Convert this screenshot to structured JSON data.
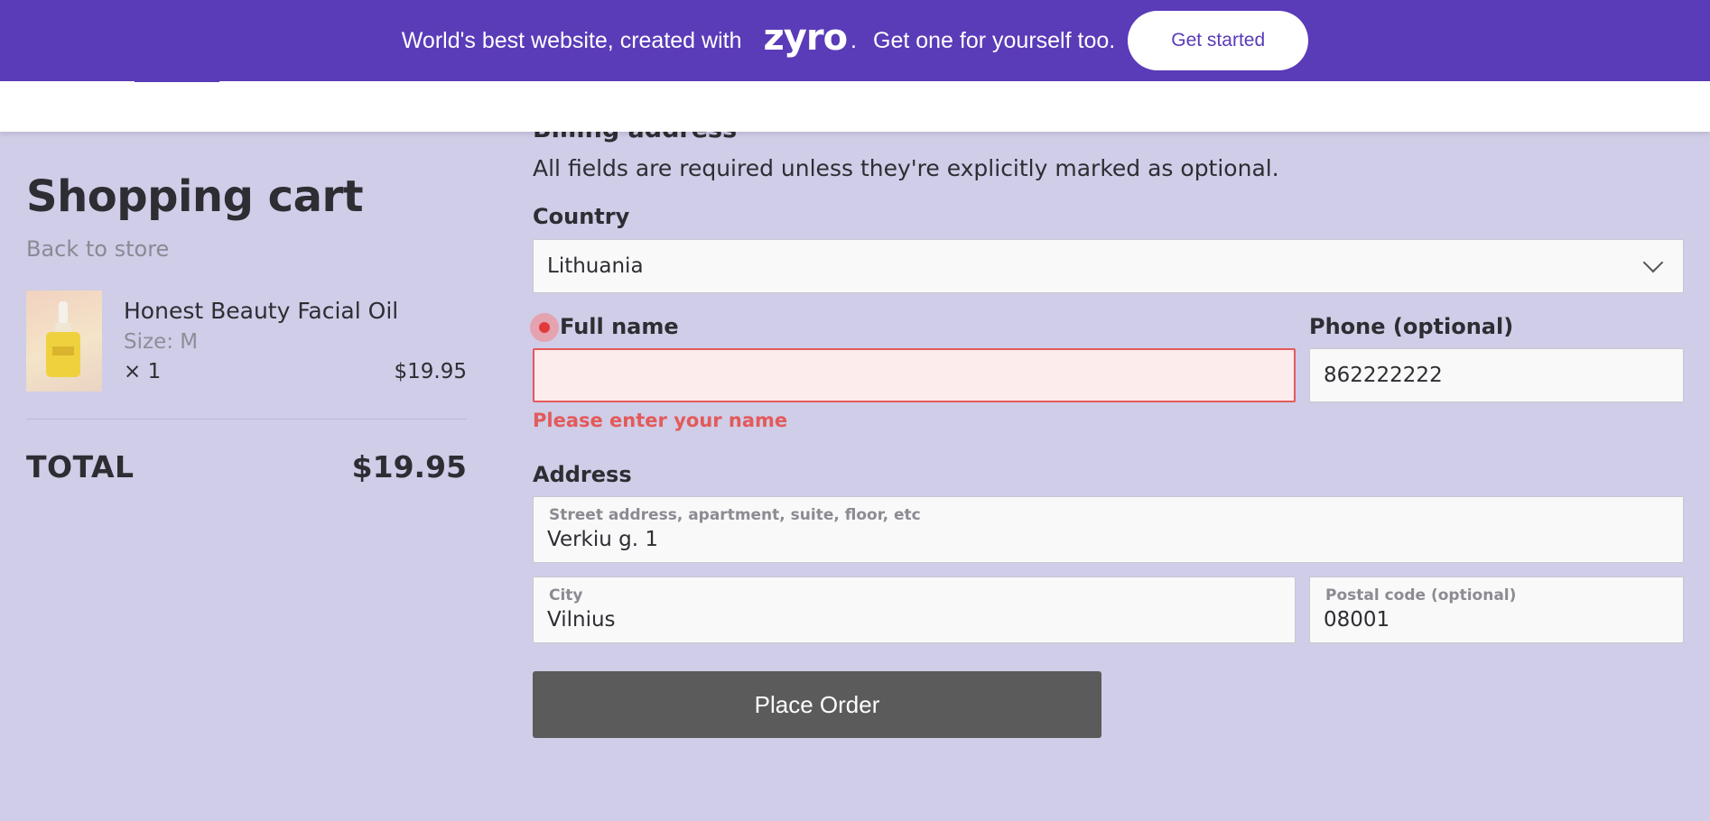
{
  "promo": {
    "text_before": "World's best website, created with",
    "brand": "zyro",
    "dot": ".",
    "text_after": "Get one for yourself too.",
    "cta_label": "Get started"
  },
  "cart": {
    "title": "Shopping cart",
    "back_link": "Back to store",
    "item": {
      "name": "Honest Beauty Facial Oil",
      "size": "Size: M",
      "quantity": "× 1",
      "price": "$19.95"
    },
    "total_label": "TOTAL",
    "total_value": "$19.95"
  },
  "billing": {
    "heading": "Billing address",
    "help_text": "All fields are required unless they're explicitly marked as optional.",
    "country": {
      "label": "Country",
      "value": "Lithuania"
    },
    "full_name": {
      "label": "Full name",
      "value": "",
      "error": "Please enter your name"
    },
    "phone": {
      "label": "Phone (optional)",
      "value": "862222222"
    },
    "address": {
      "label": "Address",
      "street_label": "Street address, apartment, suite, floor, etc",
      "street_value": "Verkiu g. 1",
      "city_label": "City",
      "city_value": "Vilnius",
      "postal_label": "Postal code (optional)",
      "postal_value": "08001"
    },
    "submit_label": "Place Order"
  },
  "colors": {
    "banner": "#5a3bb8",
    "page_bg": "#cfcde7",
    "error": "#e35a5a",
    "button": "#5b5b5b"
  }
}
